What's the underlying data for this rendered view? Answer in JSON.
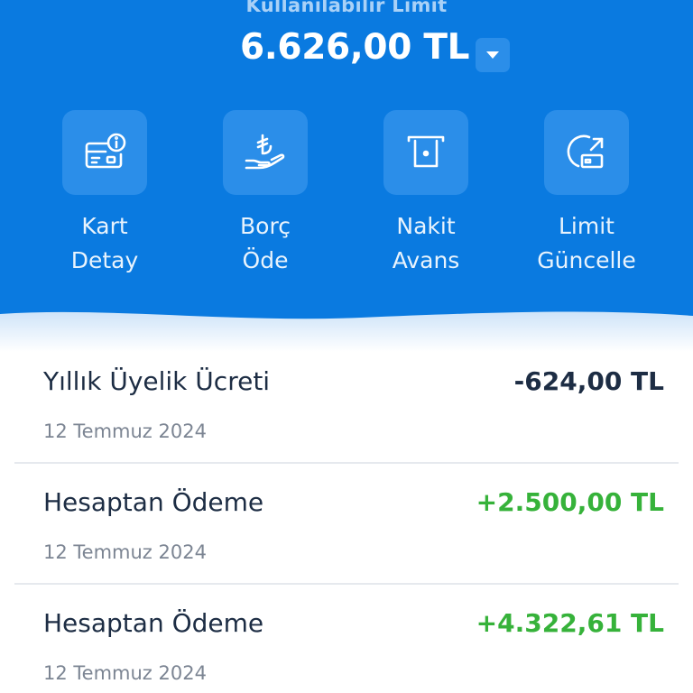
{
  "header": {
    "limit_label": "Kullanılabilir Limit",
    "limit_amount": "6.626,00 TL",
    "toggle_icon": "chevron-down-icon",
    "actions": [
      {
        "label": "Kart\nDetay",
        "icon": "card-info-icon"
      },
      {
        "label": "Borç\nÖde",
        "icon": "lira-hand-icon"
      },
      {
        "label": "Nakit\nAvans",
        "icon": "atm-icon"
      },
      {
        "label": "Limit\nGüncelle",
        "icon": "limit-refresh-icon"
      }
    ]
  },
  "transactions": [
    {
      "title": "Yıllık Üyelik Ücreti",
      "date": "12 Temmuz 2024",
      "amount": "-624,00 TL",
      "type": "debit"
    },
    {
      "title": "Hesaptan Ödeme",
      "date": "12 Temmuz 2024",
      "amount": "+2.500,00 TL",
      "type": "credit"
    },
    {
      "title": "Hesaptan Ödeme",
      "date": "12 Temmuz 2024",
      "amount": "+4.322,61 TL",
      "type": "credit"
    }
  ],
  "colors": {
    "brand_blue": "#0a7ae0",
    "tile_blue": "#2b8ee9",
    "credit_green": "#36b23a",
    "text_dark": "#1d2d44"
  }
}
